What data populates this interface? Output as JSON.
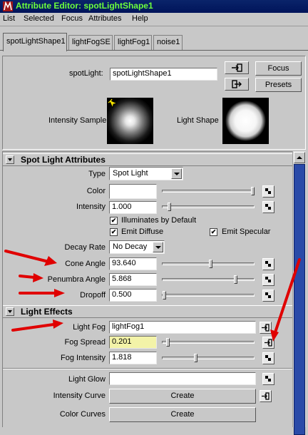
{
  "window": {
    "title": "Attribute Editor: spotLightShape1"
  },
  "menubar": {
    "items": [
      "List",
      "Selected",
      "Focus",
      "Attributes",
      "Help"
    ]
  },
  "tabs": [
    {
      "label": "spotLightShape1",
      "active": true
    },
    {
      "label": "lightFogSE",
      "active": false
    },
    {
      "label": "lightFog1",
      "active": false
    },
    {
      "label": "noise1",
      "active": false
    }
  ],
  "node": {
    "label": "spotLight:",
    "value": "spotLightShape1",
    "focus_label": "Focus",
    "presets_label": "Presets"
  },
  "samples": {
    "intensity_label": "Intensity Sample",
    "shape_label": "Light Shape"
  },
  "spot_light_section": {
    "title": "Spot Light Attributes",
    "type_label": "Type",
    "type_value": "Spot Light",
    "color_label": "Color",
    "color_value": "#ffffff",
    "color_slider": 0.98,
    "intensity_label": "Intensity",
    "intensity_value": "1.000",
    "intensity_slider": 0.08,
    "illuminates_default_label": "Illuminates by Default",
    "illuminates_default_checked": true,
    "emit_diffuse_label": "Emit Diffuse",
    "emit_diffuse_checked": true,
    "emit_specular_label": "Emit Specular",
    "emit_specular_checked": true,
    "decay_rate_label": "Decay Rate",
    "decay_rate_value": "No Decay",
    "cone_angle_label": "Cone Angle",
    "cone_angle_value": "93.640",
    "cone_angle_slider": 0.52,
    "penumbra_angle_label": "Penumbra Angle",
    "penumbra_angle_value": "5.868",
    "penumbra_angle_slider": 0.79,
    "dropoff_label": "Dropoff",
    "dropoff_value": "0.500",
    "dropoff_slider": 0.02
  },
  "light_effects_section": {
    "title": "Light Effects",
    "light_fog_label": "Light Fog",
    "light_fog_value": "lightFog1",
    "fog_spread_label": "Fog Spread",
    "fog_spread_value": "0.201",
    "fog_spread_slider": 0.06,
    "fog_intensity_label": "Fog Intensity",
    "fog_intensity_value": "1.818",
    "fog_intensity_slider": 0.36,
    "light_glow_label": "Light Glow",
    "light_glow_value": "",
    "intensity_curve_label": "Intensity Curve",
    "intensity_curve_button": "Create",
    "color_curves_label": "Color Curves",
    "color_curves_button": "Create"
  },
  "colors": {
    "title_text": "#6dff3c",
    "title_bar": "#0a246a",
    "annotation_arrow": "#e00000",
    "panel_bg": "#c8c8c8",
    "highlight_field": "#f3f3a8",
    "scroll_thumb": "#2a4aa8"
  }
}
